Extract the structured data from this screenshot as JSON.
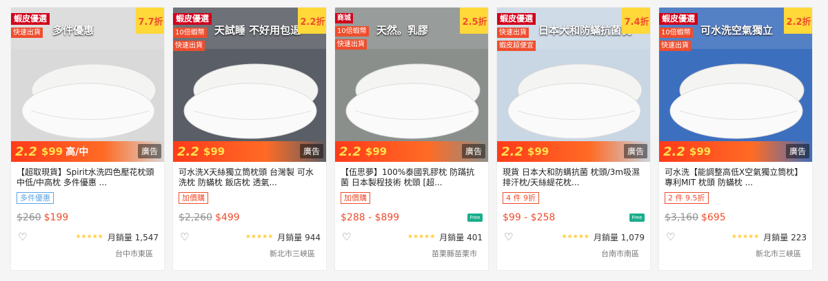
{
  "products": [
    {
      "discount": "7.7折",
      "tags": [
        "蝦皮優選",
        "快速出貨"
      ],
      "promo_image_text": "多件優惠",
      "band_text": "高/中",
      "ad_label": "廣告",
      "title": "【超取現貨】Spirit水洗四色壓花枕頭 中低/中高枕 多件優惠 ...",
      "promo_label": "多件優惠",
      "promo_style": "blue",
      "price_old": "$260",
      "price_now": "$199",
      "free_ship": false,
      "sales": "月銷量 1,547",
      "location": "台中市東區",
      "bg": "#d9d9d9"
    },
    {
      "discount": "2.2折",
      "tags": [
        "蝦皮優選",
        "10倍蝦幣",
        "快速出貨"
      ],
      "promo_image_text": "天試睡 不好用包退",
      "band_text": "",
      "ad_label": "廣告",
      "title": "可水洗X天絲獨立筒枕頭 台灣製 可水洗枕 防蟎枕 飯店枕 透氣...",
      "promo_label": "加價購",
      "promo_style": "red",
      "price_old": "$2,260",
      "price_now": "$499",
      "free_ship": false,
      "sales": "月銷量 944",
      "location": "新北市三峽區",
      "bg": "#5a5e66"
    },
    {
      "discount": "2.5折",
      "tags": [
        "商城",
        "10倍蝦幣",
        "快速出貨"
      ],
      "promo_image_text": "天然。乳膠",
      "band_text": "",
      "ad_label": "廣告",
      "title": "【伍思夢】100%泰國乳膠枕 防蹣抗菌 日本製程技術 枕頭 [超...",
      "promo_label": "加價購",
      "promo_style": "red",
      "price_old": "",
      "price_now": "$288 - $899",
      "free_ship": true,
      "sales": "月銷量 401",
      "location": "苗栗縣苗栗市",
      "bg": "#8a8f8c"
    },
    {
      "discount": "7.4折",
      "tags": [
        "蝦皮優選",
        "快速出貨",
        "蝦皮超便宜"
      ],
      "promo_image_text": "日本大和防蟎抗菌枕",
      "band_text": "",
      "ad_label": "廣告",
      "title": "現貨 日本大和防螨抗菌 枕頭/3m吸濕排汗枕/天絲緹花枕...",
      "promo_label": "4 件 9折",
      "promo_style": "red",
      "price_old": "",
      "price_now": "$99 - $258",
      "free_ship": true,
      "sales": "月銷量 1,079",
      "location": "台南市南區",
      "bg": "#c9d6e4"
    },
    {
      "discount": "2.2折",
      "tags": [
        "蝦皮優選",
        "10倍蝦幣",
        "快速出貨"
      ],
      "promo_image_text": "可水洗空氣獨立",
      "band_text": "",
      "ad_label": "廣告",
      "title": "可水洗【能調整高低X空氣獨立筒枕】專利MIT 枕頭 防蟎枕 ...",
      "promo_label": "2 件 9.5折",
      "promo_style": "red",
      "price_old": "$3,160",
      "price_now": "$695",
      "free_ship": false,
      "sales": "月銷量 223",
      "location": "新北市三峽區",
      "bg": "#3d6fbf"
    }
  ],
  "band_promo": {
    "mark": "2.2",
    "price": "$99"
  },
  "free_ship_label": "Free",
  "heart_icon": "heart-icon",
  "stars": "★★★★★",
  "colors": {
    "accent": "#ee4d2d",
    "discount_bg": "#ffd839",
    "star": "#ffce3d"
  }
}
